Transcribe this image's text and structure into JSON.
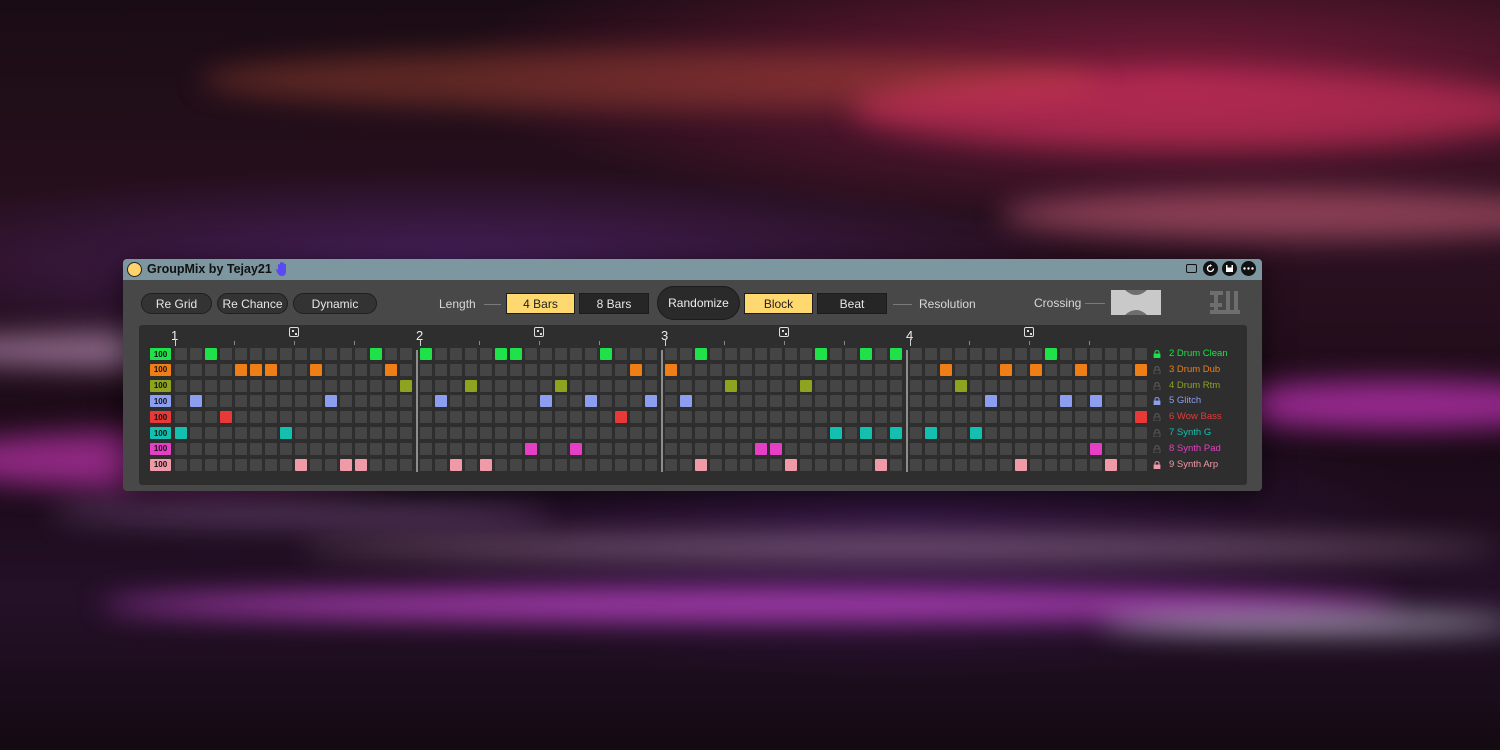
{
  "window": {
    "title": "GroupMix by Tejay21"
  },
  "toolbar": {
    "re_grid": "Re Grid",
    "re_chance": "Re Chance",
    "dynamic": "Dynamic",
    "length_label": "Length",
    "length_options": [
      "4 Bars",
      "8 Bars"
    ],
    "length_selected": "4 Bars",
    "randomize": "Randomize",
    "resolution_options": [
      "Block",
      "Beat"
    ],
    "resolution_selected": "Block",
    "resolution_label": "Resolution",
    "crossing_label": "Crossing"
  },
  "colors": {
    "accent": "#ffd970",
    "cell_off": "#454545",
    "grid_bg": "#2e2e2e",
    "panel_bg": "#484848",
    "titlebar": "#7d97a0"
  },
  "bars": [
    "1",
    "2",
    "3",
    "4"
  ],
  "tracks": [
    {
      "name": "2 Drum Clean",
      "velocity": "100",
      "color": "#1fe14a",
      "locked": true,
      "active": [
        2,
        13,
        16,
        21,
        22,
        28,
        34,
        42,
        45,
        47,
        57
      ]
    },
    {
      "name": "3 Drum Dub",
      "velocity": "100",
      "color": "#f07e17",
      "locked": false,
      "active": [
        4,
        5,
        6,
        9,
        14,
        30,
        32,
        50,
        54,
        56,
        59,
        63
      ]
    },
    {
      "name": "4 Drum Rtm",
      "velocity": "100",
      "color": "#8fa41e",
      "locked": false,
      "active": [
        15,
        19,
        25,
        36,
        41,
        51
      ]
    },
    {
      "name": "5 Glitch",
      "velocity": "100",
      "color": "#8c9ef0",
      "locked": true,
      "active": [
        1,
        10,
        17,
        24,
        27,
        31,
        33,
        53,
        58,
        60
      ]
    },
    {
      "name": "6 Wow Bass",
      "velocity": "100",
      "color": "#e83838",
      "locked": false,
      "active": [
        3,
        29,
        63
      ]
    },
    {
      "name": "7 Synth G",
      "velocity": "100",
      "color": "#13c0b0",
      "locked": false,
      "active": [
        0,
        7,
        43,
        45,
        47,
        49,
        52
      ]
    },
    {
      "name": "8 Synth Pad",
      "velocity": "100",
      "color": "#e43fc5",
      "locked": false,
      "active": [
        23,
        26,
        38,
        39,
        60
      ]
    },
    {
      "name": "9 Synth Arp",
      "velocity": "100",
      "color": "#f09aa8",
      "locked": true,
      "active": [
        8,
        11,
        12,
        18,
        20,
        34,
        40,
        46,
        55,
        61
      ]
    }
  ]
}
